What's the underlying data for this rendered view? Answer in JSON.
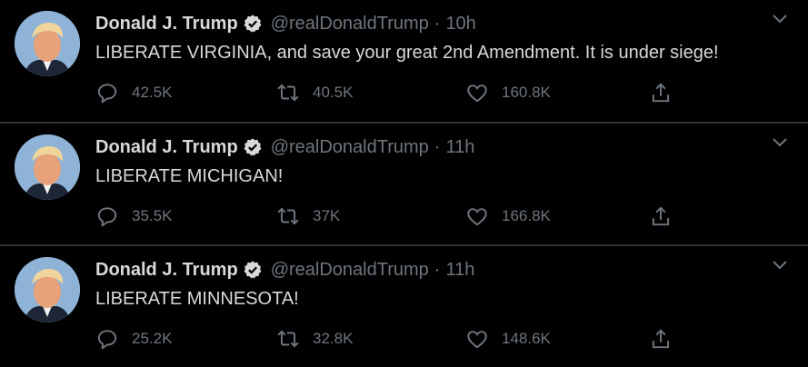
{
  "colors": {
    "background": "#000000",
    "text": "#d9d9d9",
    "muted": "#6e767d",
    "divider": "#2f3336"
  },
  "icons": {
    "reply": "speech-bubble-icon",
    "retweet": "retweet-arrows-icon",
    "like": "heart-icon",
    "share": "share-upload-icon",
    "verified": "verified-badge-icon",
    "more": "chevron-down-icon"
  },
  "tweets": [
    {
      "name": "Donald J. Trump",
      "handle": "@realDonaldTrump",
      "separator": "·",
      "time": "10h",
      "text": "LIBERATE VIRGINIA, and save your great 2nd Amendment. It is under siege!",
      "replies": "42.5K",
      "retweets": "40.5K",
      "likes": "160.8K"
    },
    {
      "name": "Donald J. Trump",
      "handle": "@realDonaldTrump",
      "separator": "·",
      "time": "11h",
      "text": "LIBERATE MICHIGAN!",
      "replies": "35.5K",
      "retweets": "37K",
      "likes": "166.8K"
    },
    {
      "name": "Donald J. Trump",
      "handle": "@realDonaldTrump",
      "separator": "·",
      "time": "11h",
      "text": "LIBERATE MINNESOTA!",
      "replies": "25.2K",
      "retweets": "32.8K",
      "likes": "148.6K"
    }
  ]
}
